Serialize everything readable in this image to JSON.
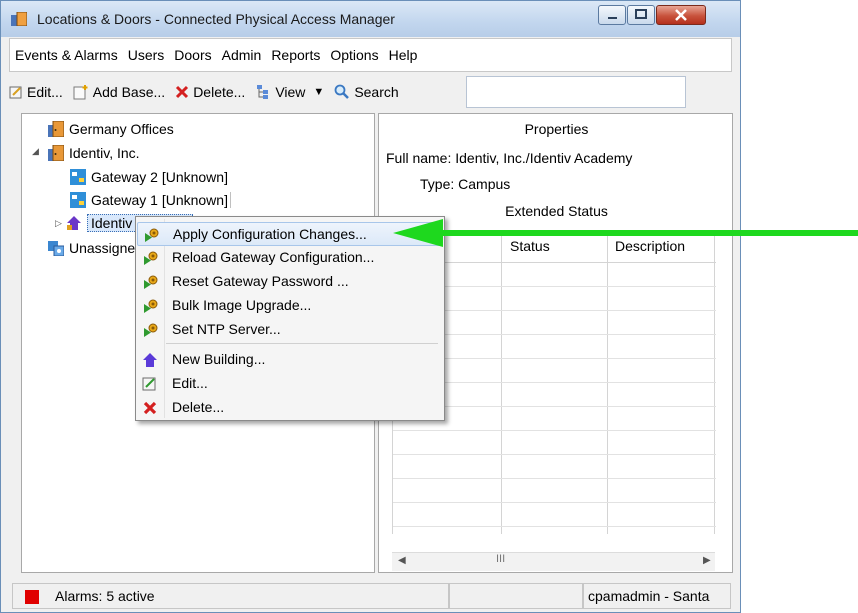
{
  "window": {
    "title": "Locations & Doors - Connected Physical Access Manager"
  },
  "menubar": [
    "Events & Alarms",
    "Users",
    "Doors",
    "Admin",
    "Reports",
    "Options",
    "Help"
  ],
  "toolbar": {
    "edit": "Edit...",
    "add_base": "Add Base...",
    "delete": "Delete...",
    "view": "View",
    "search": "Search"
  },
  "tree": {
    "germany": "Germany Offices",
    "identiv_inc": "Identiv, Inc.",
    "gateway2": "Gateway  2 [Unknown]",
    "gateway1": "Gateway 1 [Unknown]",
    "identiv_academy": "Identiv",
    "unassigned": "Unassigne"
  },
  "properties": {
    "heading": "Properties",
    "full_name": "Full name: Identiv, Inc./Identiv Academy",
    "type": "Type: Campus",
    "extended_status": "Extended Status",
    "col_status": "Status",
    "col_description": "Description",
    "scroll_thumb": "III"
  },
  "context_menu": {
    "apply": "Apply Configuration Changes...",
    "reload": "Reload Gateway Configuration...",
    "reset": "Reset Gateway Password ...",
    "bulk": "Bulk Image Upgrade...",
    "ntp": "Set NTP Server...",
    "new_building": "New Building...",
    "edit": "Edit...",
    "delete": "Delete..."
  },
  "statusbar": {
    "alarms": "Alarms: 5 active",
    "user": "cpamadmin - Santa"
  },
  "colors": {
    "annotation_arrow": "#1ed81e",
    "alarm": "#e00000",
    "delete_x": "#d42020"
  }
}
